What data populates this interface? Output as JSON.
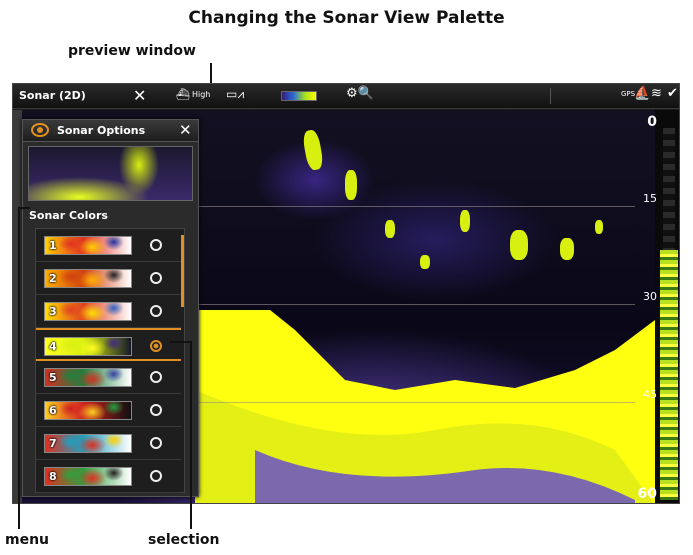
{
  "figure": {
    "title": "Changing the Sonar View Palette",
    "callouts": {
      "preview": "preview window",
      "menu": "menu",
      "selection": "selection"
    }
  },
  "topbar": {
    "title": "Sonar (2D)",
    "close_glyph": "✕",
    "frequency_label": "High",
    "frequency_icon": "boat-high-icon",
    "chart_glyph": "▭⩘",
    "zoom_glyph": "⚙🔍",
    "gps_label": "GPS",
    "status_icons": [
      "gps-icon",
      "boat-icon",
      "sonar-icon",
      "check-circle-icon"
    ],
    "status_glyphs": [
      "⛵",
      "≋",
      "✔"
    ]
  },
  "sonar": {
    "depths": [
      "0",
      "15",
      "30",
      "45",
      "60"
    ]
  },
  "menu": {
    "title": "Sonar Options",
    "close_glyph": "✕",
    "section_label": "Sonar Colors",
    "palettes": [
      {
        "number": "1",
        "selected": false,
        "colors": [
          "#ffffff",
          "#e03020",
          "#ffd000",
          "#2030a0"
        ]
      },
      {
        "number": "2",
        "selected": false,
        "colors": [
          "#ffffff",
          "#d04010",
          "#ffb000",
          "#202020"
        ]
      },
      {
        "number": "3",
        "selected": false,
        "colors": [
          "#ffffff",
          "#e04020",
          "#ffe000",
          "#3060c0"
        ]
      },
      {
        "number": "4",
        "selected": true,
        "colors": [
          "#141828",
          "#d8f010",
          "#ffff20",
          "#402a80"
        ]
      },
      {
        "number": "5",
        "selected": false,
        "colors": [
          "#ffffff",
          "#208040",
          "#d03020",
          "#3040a0"
        ]
      },
      {
        "number": "6",
        "selected": false,
        "colors": [
          "#101010",
          "#d02020",
          "#ffd020",
          "#20a040"
        ]
      },
      {
        "number": "7",
        "selected": false,
        "colors": [
          "#ffffff",
          "#20a0c0",
          "#e03020",
          "#ffd000"
        ]
      },
      {
        "number": "8",
        "selected": false,
        "colors": [
          "#ffffff",
          "#30a040",
          "#e03020",
          "#202020"
        ]
      }
    ]
  },
  "colors": {
    "accent": "#e09020",
    "sonar_target": "#d8f010"
  }
}
